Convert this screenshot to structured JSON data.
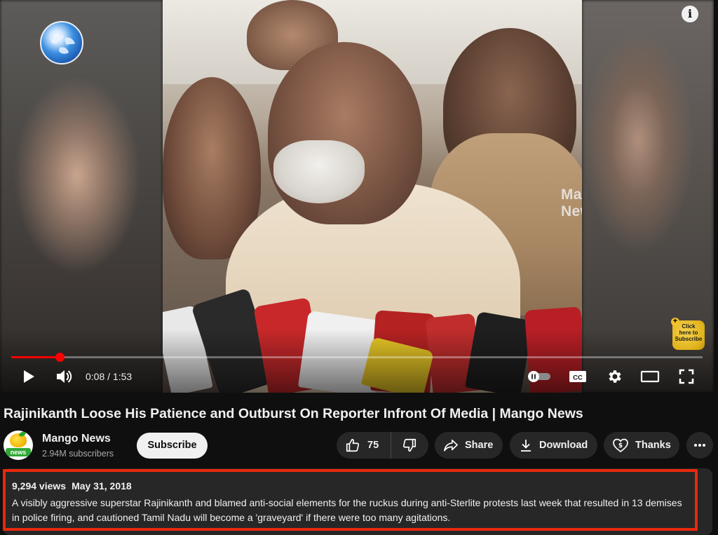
{
  "player": {
    "watermark": "Mango News",
    "info_icon": "info-icon",
    "subscribe_badge": {
      "line1": "Click",
      "line2": "here to",
      "line3": "Subscribe"
    },
    "current_time": "0:08 / 1:53",
    "progress": 0.07,
    "icons": [
      "play-icon",
      "volume-icon",
      "autoplay-toggle-icon",
      "captions-icon",
      "settings-icon",
      "theater-mode-icon",
      "fullscreen-icon"
    ],
    "cc_label": "CC",
    "progress_color": "#ff0000"
  },
  "video": {
    "title": "Rajinikanth Loose His Patience and Outburst On Reporter Infront Of Media | Mango News"
  },
  "channel": {
    "name": "Mango News",
    "subscribers": "2.94M subscribers",
    "avatar_text": "news",
    "subscribe_label": "Subscribe"
  },
  "actions": {
    "likes": "75",
    "share_label": "Share",
    "download_label": "Download",
    "thanks_label": "Thanks"
  },
  "description": {
    "views": "9,294 views",
    "date": "May 31, 2018",
    "text": "A visibly aggressive superstar Rajinikanth and blamed anti-social elements for the ruckus during anti-Sterlite protests last week that resulted in 13 demises in police firing, and cautioned Tamil Nadu will become a 'graveyard' if there were too many agitations.",
    "highlight_color": "#e8290c"
  }
}
